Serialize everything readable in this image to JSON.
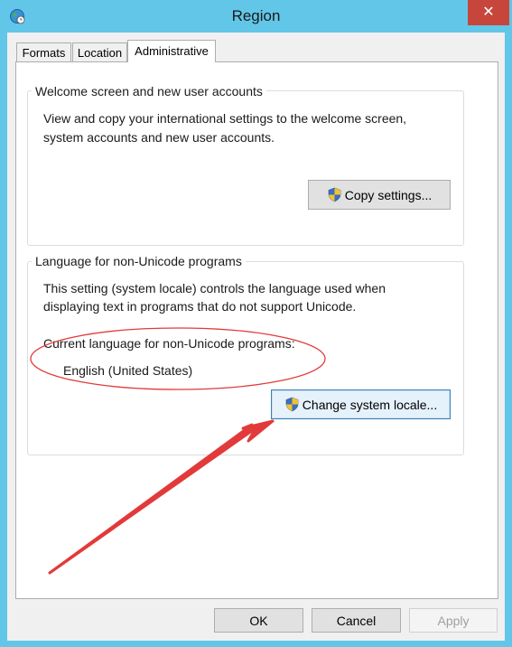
{
  "window": {
    "title": "Region",
    "close_glyph": "✕"
  },
  "tabs": [
    {
      "label": "Formats",
      "active": false
    },
    {
      "label": "Location",
      "active": false
    },
    {
      "label": "Administrative",
      "active": true
    }
  ],
  "welcome": {
    "title": "Welcome screen and new user accounts",
    "desc_line1": "View and copy your international settings to the welcome screen,",
    "desc_line2": "system accounts and new user accounts.",
    "button": "Copy settings..."
  },
  "unicode": {
    "title": "Language for non-Unicode programs",
    "desc_line1": "This setting (system locale) controls the language used when",
    "desc_line2": "displaying text in programs that do not support Unicode.",
    "current_label": "Current language for non-Unicode programs:",
    "current_value": "English (United States)",
    "button": "Change system locale..."
  },
  "footer": {
    "ok": "OK",
    "cancel": "Cancel",
    "apply": "Apply"
  },
  "icons": {
    "app": "globe-clock-icon",
    "uac": "uac-shield-icon",
    "close": "close-icon"
  },
  "colors": {
    "frame": "#62c6e8",
    "close_button": "#c7463c",
    "annotation": "#e23a3a"
  }
}
